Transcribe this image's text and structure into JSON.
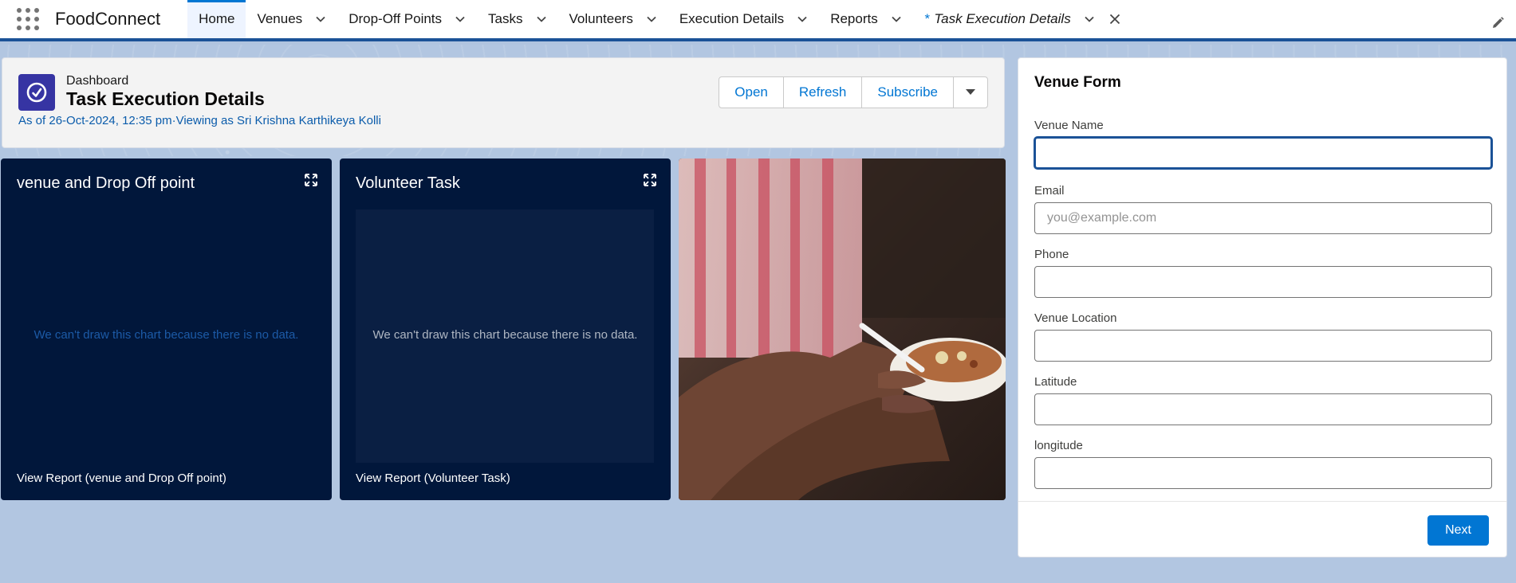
{
  "nav": {
    "app_name": "FoodConnect",
    "tabs": [
      {
        "label": "Home"
      },
      {
        "label": "Venues"
      },
      {
        "label": "Drop-Off Points"
      },
      {
        "label": "Tasks"
      },
      {
        "label": "Volunteers"
      },
      {
        "label": "Execution Details"
      },
      {
        "label": "Reports"
      },
      {
        "label": "Task Execution Details",
        "prefix": "*"
      }
    ]
  },
  "dashboard": {
    "eyebrow": "Dashboard",
    "title": "Task Execution Details",
    "subtitle": "As of 26-Oct-2024, 12:35 pm·Viewing as Sri Krishna Karthikeya Kolli",
    "buttons": {
      "open": "Open",
      "refresh": "Refresh",
      "subscribe": "Subscribe"
    }
  },
  "cards": [
    {
      "title": "venue and Drop Off point",
      "nodata": "We can't draw this chart because there is no data.",
      "link": "View Report (venue and Drop Off point)"
    },
    {
      "title": "Volunteer Task",
      "nodata": "We can't draw this chart because there is no data.",
      "link": "View Report (Volunteer Task)"
    }
  ],
  "form": {
    "title": "Venue Form",
    "fields": [
      {
        "label": "Venue Name",
        "value": "",
        "placeholder": ""
      },
      {
        "label": "Email",
        "value": "",
        "placeholder": "you@example.com"
      },
      {
        "label": "Phone",
        "value": "",
        "placeholder": ""
      },
      {
        "label": "Venue Location",
        "value": "",
        "placeholder": ""
      },
      {
        "label": "Latitude",
        "value": "",
        "placeholder": ""
      },
      {
        "label": "longitude",
        "value": "",
        "placeholder": ""
      }
    ],
    "next_label": "Next"
  },
  "colors": {
    "brand": "#0176d3",
    "nav_border": "#1b5297",
    "card_bg": "#01173b",
    "dashboard_icon": "#3634a3",
    "page_bg": "#b0c4df"
  },
  "icons": {
    "app_launcher": "grid-dots-icon",
    "dashboard": "gauge-icon",
    "expand": "expand-icon",
    "dropdown": "chevron-down-icon",
    "close": "close-icon",
    "edit": "pencil-icon"
  }
}
